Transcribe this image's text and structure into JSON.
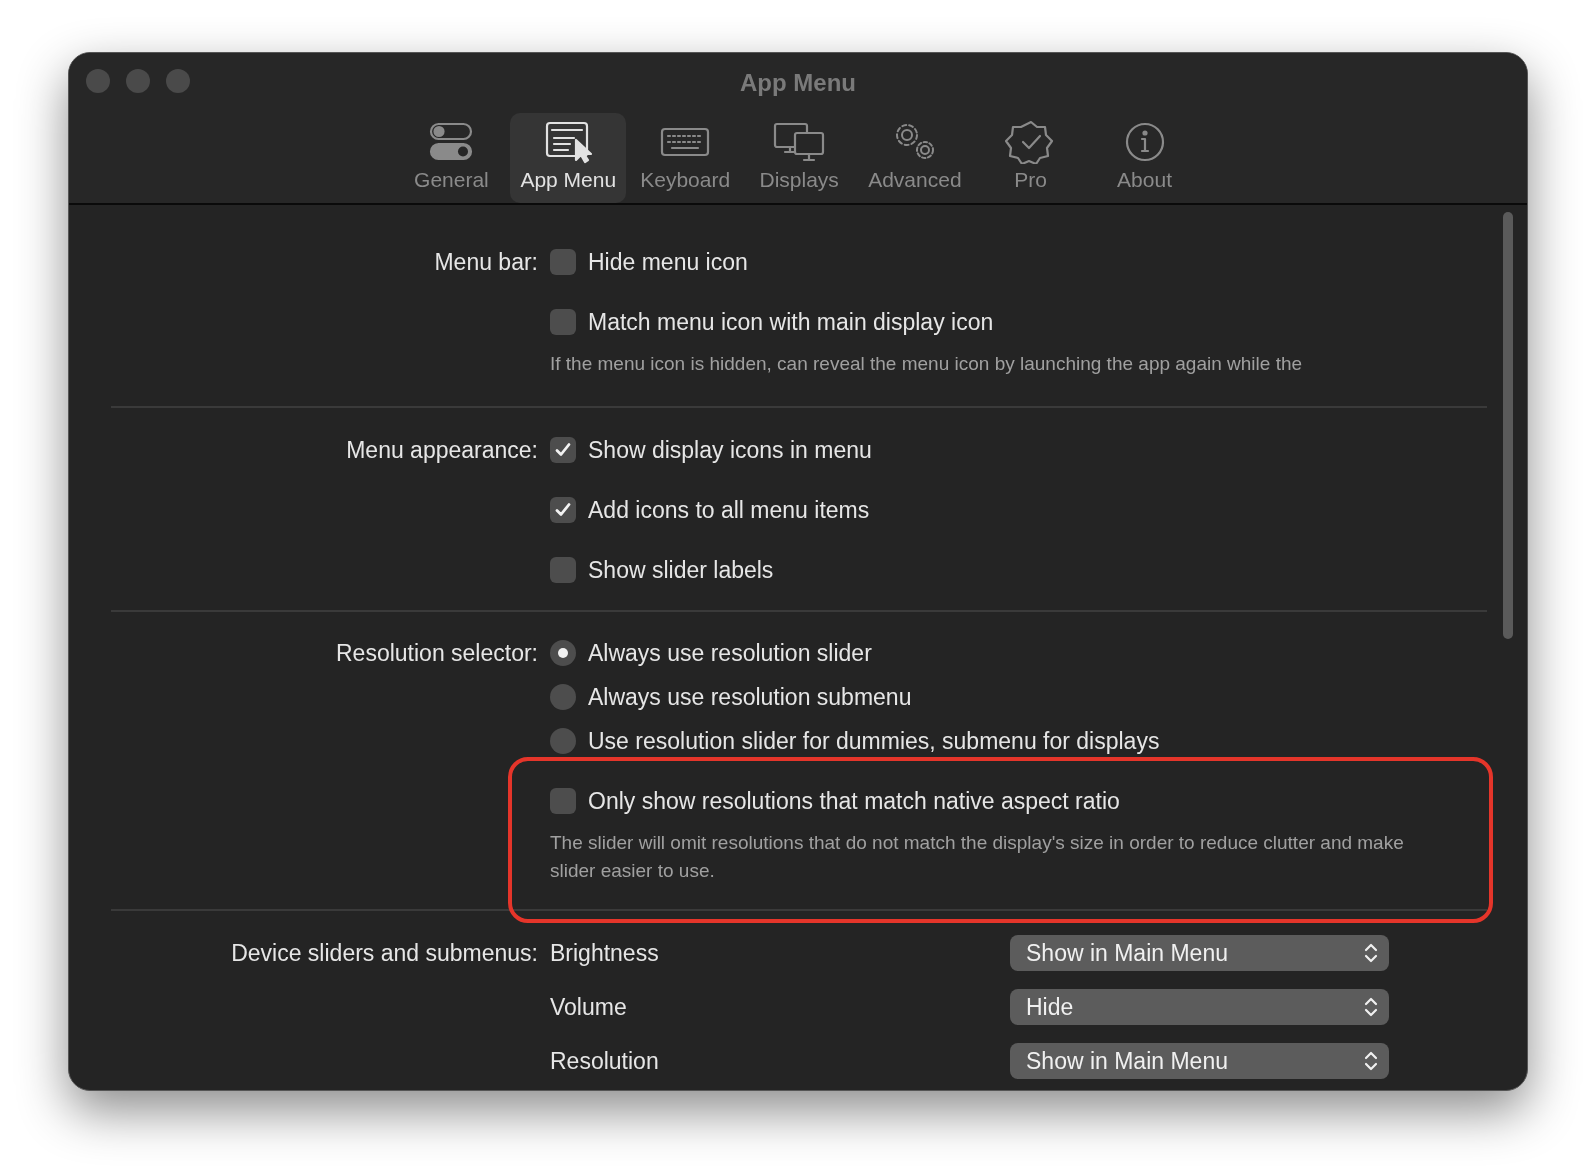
{
  "window": {
    "title": "App Menu"
  },
  "toolbar": [
    {
      "kind": "toggles",
      "label": "General",
      "selected": false
    },
    {
      "kind": "menu",
      "label": "App Menu",
      "selected": true
    },
    {
      "kind": "keyboard",
      "label": "Keyboard",
      "selected": false
    },
    {
      "kind": "displays",
      "label": "Displays",
      "selected": false
    },
    {
      "kind": "gears",
      "label": "Advanced",
      "selected": false
    },
    {
      "kind": "badge",
      "label": "Pro",
      "selected": false
    },
    {
      "kind": "info",
      "label": "About",
      "selected": false
    }
  ],
  "sections": [
    {
      "label": "Menu bar:",
      "items": [
        {
          "kind": "checkbox",
          "label": "Hide menu icon",
          "checked": false
        },
        {
          "kind": "checkbox",
          "label": "Match menu icon with main display icon",
          "checked": false
        },
        {
          "kind": "hint",
          "text": "If the menu icon is hidden, can reveal the menu icon by launching the app again while the"
        }
      ]
    },
    {
      "label": "Menu appearance:",
      "items": [
        {
          "kind": "checkbox",
          "label": "Show display icons in menu",
          "checked": true
        },
        {
          "kind": "checkbox",
          "label": "Add icons to all menu items",
          "checked": true
        },
        {
          "kind": "checkbox",
          "label": "Show slider labels",
          "checked": false
        }
      ]
    },
    {
      "label": "Resolution selector:",
      "items": [
        {
          "kind": "radio",
          "label": "Always use resolution slider",
          "selected": true
        },
        {
          "kind": "radio",
          "label": "Always use resolution submenu",
          "selected": false
        },
        {
          "kind": "radio",
          "label": "Use resolution slider for dummies, submenu for displays",
          "selected": false
        },
        {
          "kind": "group",
          "highlighted": true,
          "items": [
            {
              "kind": "checkbox",
              "label": "Only show resolutions that match native aspect ratio",
              "checked": false
            },
            {
              "kind": "hint",
              "text": "The slider will omit resolutions that do not match the display's size in order to reduce clutter and make slider easier to use."
            }
          ]
        }
      ]
    },
    {
      "label": "Device sliders and submenus:",
      "items": [
        {
          "kind": "popup",
          "label": "Brightness",
          "value": "Show in Main Menu"
        },
        {
          "kind": "popup",
          "label": "Volume",
          "value": "Hide"
        },
        {
          "kind": "popup",
          "label": "Resolution",
          "value": "Show in Main Menu"
        }
      ]
    }
  ]
}
